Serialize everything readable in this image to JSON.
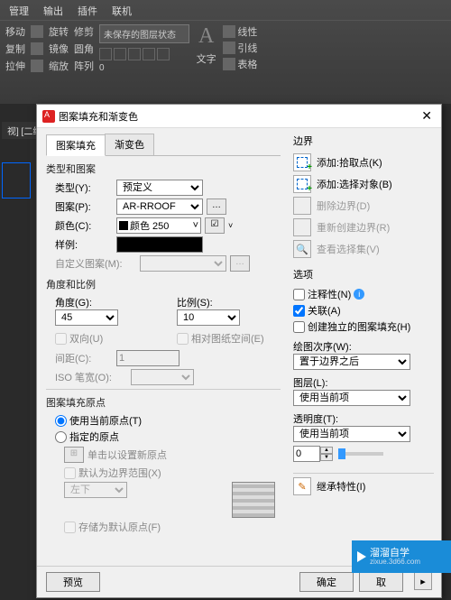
{
  "ribbon": {
    "tabs": [
      "管理",
      "输出",
      "插件",
      "联机"
    ],
    "panel1": {
      "r1": [
        "移动",
        "旋转",
        "修剪"
      ],
      "r2": [
        "复制",
        "镜像",
        "圆角"
      ],
      "r3": [
        "拉伸",
        "缩放",
        "阵列"
      ]
    },
    "layer_state": "未保存的图层状态",
    "layer_num": "0",
    "text_group": "文字",
    "props": [
      "线性",
      "引线",
      "表格"
    ]
  },
  "viewport": "视] [二维",
  "dialog": {
    "title": "图案填充和渐变色",
    "tab1": "图案填充",
    "tab2": "渐变色",
    "type_group": "类型和图案",
    "type_label": "类型(Y):",
    "type_value": "预定义",
    "pattern_label": "图案(P):",
    "pattern_value": "AR-RROOF",
    "color_label": "颜色(C):",
    "color_value": "颜色 250",
    "sample_label": "样例:",
    "custom_label": "自定义图案(M):",
    "angle_group": "角度和比例",
    "angle_label": "角度(G):",
    "angle_value": "45",
    "scale_label": "比例(S):",
    "scale_value": "10",
    "double_label": "双向(U)",
    "paper_label": "相对图纸空间(E)",
    "spacing_label": "间距(C):",
    "spacing_value": "1",
    "iso_label": "ISO 笔宽(O):",
    "origin_group": "图案填充原点",
    "origin_current": "使用当前原点(T)",
    "origin_specified": "指定的原点",
    "origin_click": "单击以设置新原点",
    "origin_default_ext": "默认为边界范围(X)",
    "origin_bl": "左下",
    "origin_store": "存储为默认原点(F)",
    "boundary_title": "边界",
    "add_pick": "添加:拾取点(K)",
    "add_select": "添加:选择对象(B)",
    "remove": "删除边界(D)",
    "recreate": "重新创建边界(R)",
    "view_sel": "查看选择集(V)",
    "options_title": "选项",
    "annotative": "注释性(N)",
    "associative": "关联(A)",
    "separate": "创建独立的图案填充(H)",
    "draw_order": "绘图次序(W):",
    "draw_order_val": "置于边界之后",
    "layer_label": "图层(L):",
    "layer_val": "使用当前项",
    "transp_label": "透明度(T):",
    "transp_val": "使用当前项",
    "transp_num": "0",
    "inherit": "继承特性(I)",
    "preview": "预览",
    "ok": "确定",
    "cancel": "取"
  },
  "watermark": {
    "brand": "溜溜自学",
    "url": "zixue.3d66.com"
  }
}
